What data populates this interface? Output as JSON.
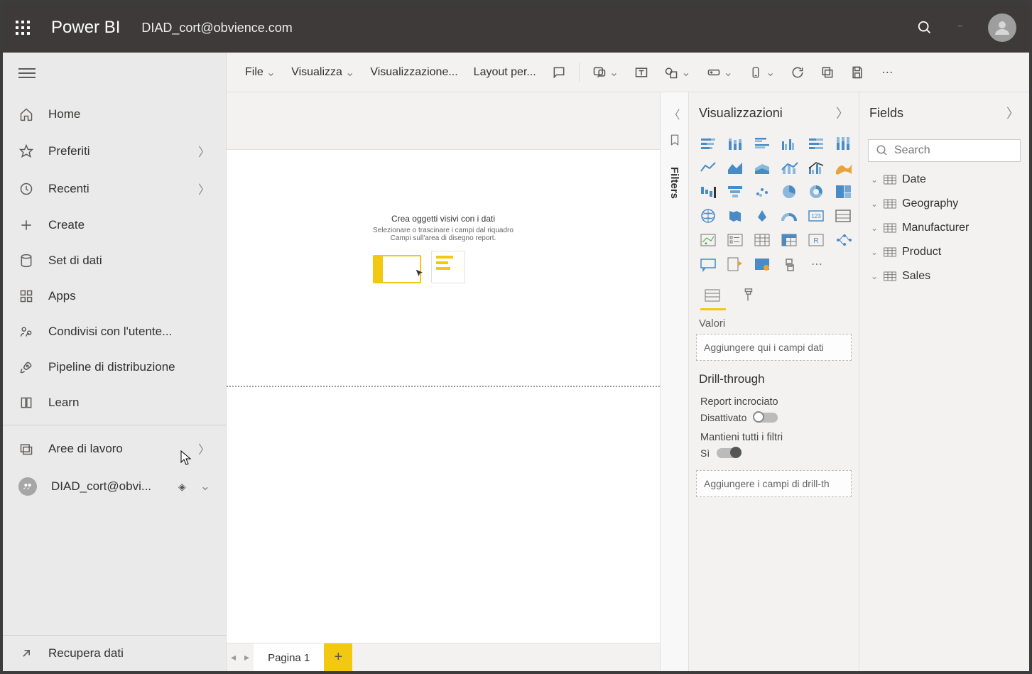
{
  "header": {
    "brand": "Power BI",
    "user_email": "DIAD_cort@obvience.com"
  },
  "leftnav": {
    "items": [
      {
        "icon": "home",
        "label": "Home",
        "chev": false
      },
      {
        "icon": "star",
        "label": "Preferiti",
        "chev": true
      },
      {
        "icon": "clock",
        "label": "Recenti",
        "chev": true
      },
      {
        "icon": "plus",
        "label": "Create",
        "chev": false
      },
      {
        "icon": "db",
        "label": "Set di dati",
        "chev": false
      },
      {
        "icon": "apps",
        "label": "Apps",
        "chev": false
      },
      {
        "icon": "share",
        "label": "Condivisi con l'utente...",
        "chev": false
      },
      {
        "icon": "rocket",
        "label": "Pipeline di distribuzione",
        "chev": false
      },
      {
        "icon": "book",
        "label": "Learn",
        "chev": false
      }
    ],
    "workspaces_label": "Aree di lavoro",
    "current_workspace": "DIAD_cort@obvi...",
    "get_data": "Recupera dati"
  },
  "toolbar": {
    "file": "File",
    "view": "Visualizza",
    "visualization": "Visualizzazione...",
    "layout": "Layout per..."
  },
  "canvas": {
    "hint_title": "Crea oggetti visivi con i dati",
    "hint_line1": "Selezionare o trascinare i campi dal riquadro",
    "hint_line2": "Campi sull'area di disegno report."
  },
  "pagetabs": {
    "page1": "Pagina 1"
  },
  "filters_label": "Filters",
  "viz": {
    "title": "Visualizzazioni",
    "values_label": "Valori",
    "drop_hint": "Aggiungere qui i campi dati",
    "drill_header": "Drill-through",
    "cross_label": "Report incrociato",
    "cross_state": "Disattivato",
    "keep_label": "Mantieni tutti i filtri",
    "keep_state": "Sì",
    "drill_drop": "Aggiungere i campi di drill-th"
  },
  "fields": {
    "title": "Fields",
    "search_placeholder": "Search",
    "tables": [
      "Date",
      "Geography",
      "Manufacturer",
      "Product",
      "Sales"
    ]
  }
}
